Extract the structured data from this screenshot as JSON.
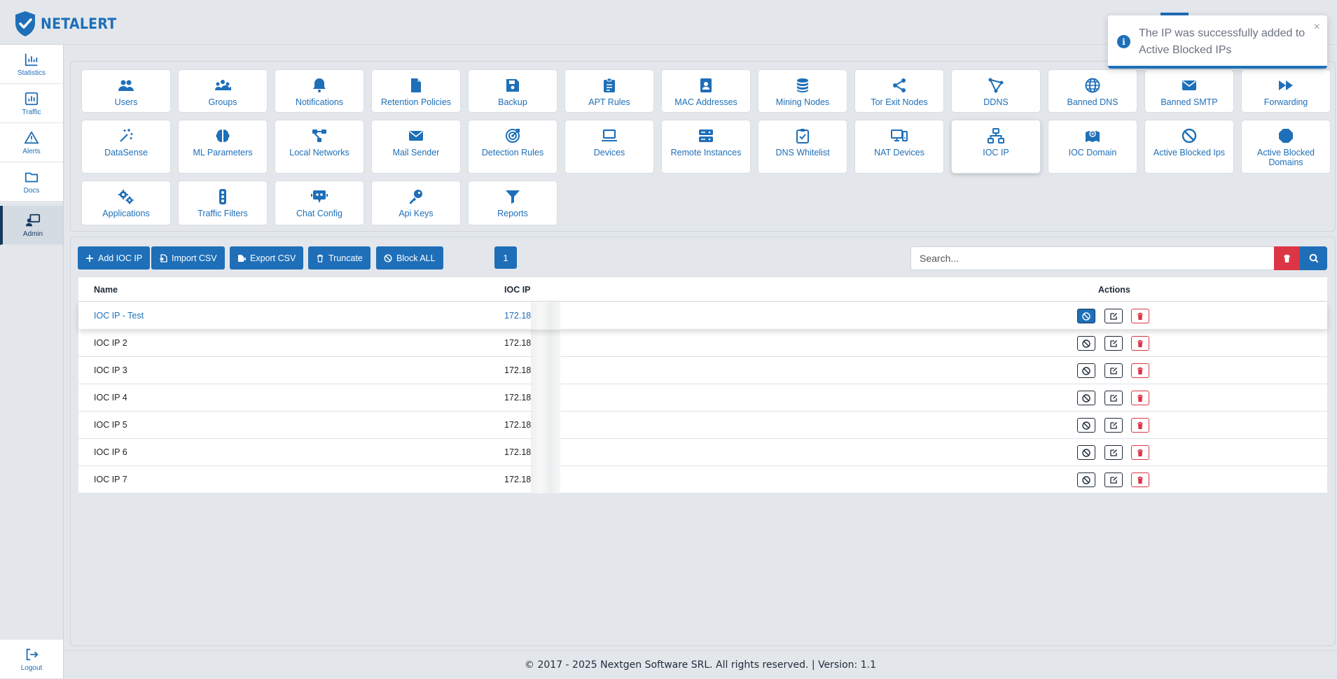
{
  "brand": {
    "name": "NETALERT"
  },
  "sidebar": {
    "items": [
      {
        "label": "Statistics",
        "icon": "chart-bar-icon"
      },
      {
        "label": "Traffic",
        "icon": "chart-square-icon"
      },
      {
        "label": "Alerts",
        "icon": "warning-triangle-icon"
      },
      {
        "label": "Docs",
        "icon": "folder-icon"
      },
      {
        "label": "Admin",
        "icon": "admin-presentation-icon",
        "active": true
      }
    ],
    "logout": {
      "label": "Logout",
      "icon": "logout-icon"
    }
  },
  "tiles": [
    {
      "label": "Users",
      "icon": "users-icon"
    },
    {
      "label": "Groups",
      "icon": "groups-icon"
    },
    {
      "label": "Notifications",
      "icon": "bell-icon"
    },
    {
      "label": "Retention Policies",
      "icon": "file-icon"
    },
    {
      "label": "Backup",
      "icon": "floppy-disk-icon"
    },
    {
      "label": "APT Rules",
      "icon": "clipboard-list-icon"
    },
    {
      "label": "MAC Addresses",
      "icon": "address-book-icon"
    },
    {
      "label": "Mining Nodes",
      "icon": "coins-icon"
    },
    {
      "label": "Tor Exit Nodes",
      "icon": "share-nodes-icon"
    },
    {
      "label": "DDNS",
      "icon": "bezier-curve-icon"
    },
    {
      "label": "Banned DNS",
      "icon": "globe-icon"
    },
    {
      "label": "Banned SMTP",
      "icon": "envelope-icon"
    },
    {
      "label": "Forwarding",
      "icon": "forward-icon"
    },
    {
      "label": "DataSense",
      "icon": "magic-wand-icon"
    },
    {
      "label": "ML Parameters",
      "icon": "brain-icon"
    },
    {
      "label": "Local Networks",
      "icon": "network-nodes-icon"
    },
    {
      "label": "Mail Sender",
      "icon": "envelope-icon"
    },
    {
      "label": "Detection Rules",
      "icon": "bullseye-icon"
    },
    {
      "label": "Devices",
      "icon": "laptop-icon"
    },
    {
      "label": "Remote Instances",
      "icon": "server-icon"
    },
    {
      "label": "DNS Whitelist",
      "icon": "clipboard-check-icon"
    },
    {
      "label": "NAT Devices",
      "icon": "desktop-devices-icon"
    },
    {
      "label": "IOC IP",
      "icon": "sitemap-icon",
      "active": true
    },
    {
      "label": "IOC Domain",
      "icon": "map-location-icon"
    },
    {
      "label": "Active Blocked Ips",
      "icon": "ban-icon"
    },
    {
      "label": "Active Blocked Domains",
      "icon": "octagon-stop-icon"
    },
    {
      "label": "Applications",
      "icon": "gears-icon"
    },
    {
      "label": "Traffic Filters",
      "icon": "traffic-light-icon"
    },
    {
      "label": "Chat Config",
      "icon": "robot-chat-icon"
    },
    {
      "label": "Api Keys",
      "icon": "key-icon"
    },
    {
      "label": "Reports",
      "icon": "filter-icon"
    }
  ],
  "toolbar": {
    "add_label": "Add IOC IP",
    "import_label": "Import CSV",
    "export_label": "Export CSV",
    "truncate_label": "Truncate",
    "block_all_label": "Block ALL",
    "page": "1"
  },
  "search": {
    "placeholder": "Search..."
  },
  "table": {
    "columns": {
      "name": "Name",
      "ip": "IOC IP",
      "actions": "Actions"
    },
    "rows": [
      {
        "name": "IOC IP - Test",
        "ip": "172.18"
      },
      {
        "name": "IOC IP 2",
        "ip": "172.18"
      },
      {
        "name": "IOC IP 3",
        "ip": "172.18"
      },
      {
        "name": "IOC IP 4",
        "ip": "172.18"
      },
      {
        "name": "IOC IP 5",
        "ip": "172.18"
      },
      {
        "name": "IOC IP 6",
        "ip": "172.18"
      },
      {
        "name": "IOC IP 7",
        "ip": "172.18"
      }
    ]
  },
  "footer": {
    "text": "© 2017 - 2025 Nextgen Software SRL. All rights reserved. | Version: 1.1"
  },
  "toast": {
    "message": "The IP was successfully added to Active Blocked IPs",
    "close": "×",
    "icon_text": "i"
  },
  "colors": {
    "primary": "#1e6fb8",
    "danger": "#dc3545",
    "background": "#e3e7ec",
    "dark": "#163a5f"
  }
}
